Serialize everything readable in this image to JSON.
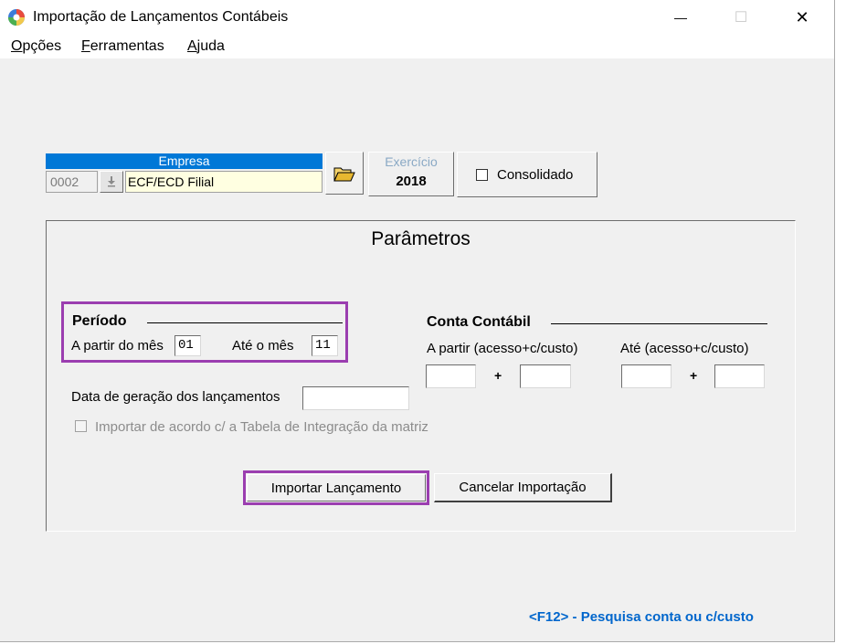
{
  "window": {
    "title": "Importação de Lançamentos Contábeis",
    "minimize_glyph": "—",
    "maximize_glyph": "☐",
    "close_glyph": "✕"
  },
  "menu": {
    "items": [
      {
        "accel": "O",
        "rest": "pções"
      },
      {
        "accel": "F",
        "rest": "erramentas"
      },
      {
        "accel": "A",
        "rest": "juda"
      }
    ]
  },
  "empresa": {
    "header": "Empresa",
    "code": "0002",
    "name": "ECF/ECD Filial",
    "lookup_icon": "arrow-down-icon",
    "folder_icon": "open-folder-icon"
  },
  "exercicio": {
    "label": "Exercício",
    "value": "2018"
  },
  "consolidado": {
    "label": "Consolidado",
    "checked": false
  },
  "parametros": {
    "title": "Parâmetros",
    "periodo": {
      "title": "Período",
      "from_label": "A partir do mês",
      "from_value": "01",
      "to_label": "Até o mês",
      "to_value": "11"
    },
    "conta": {
      "title": "Conta Contábil",
      "from_label": "A partir (acesso+c/custo)",
      "to_label": "Até (acesso+c/custo)",
      "plus": "+",
      "from_acesso": "",
      "from_custo": "",
      "to_acesso": "",
      "to_custo": ""
    },
    "data_geracao": {
      "label": "Data de geração dos lançamentos",
      "value": ""
    },
    "tabela_integracao": {
      "label": "Importar de acordo c/ a Tabela de Integração da matriz",
      "checked": false,
      "enabled": false
    }
  },
  "buttons": {
    "importar": "Importar Lançamento",
    "cancelar": "Cancelar Importação"
  },
  "footer": {
    "hint": "<F12> - Pesquisa conta ou c/custo"
  },
  "colors": {
    "accent_blue": "#0078d7",
    "highlight_purple": "#9b3eb0",
    "hint_blue": "#0066cc",
    "name_field_bg": "#ffffe1"
  }
}
